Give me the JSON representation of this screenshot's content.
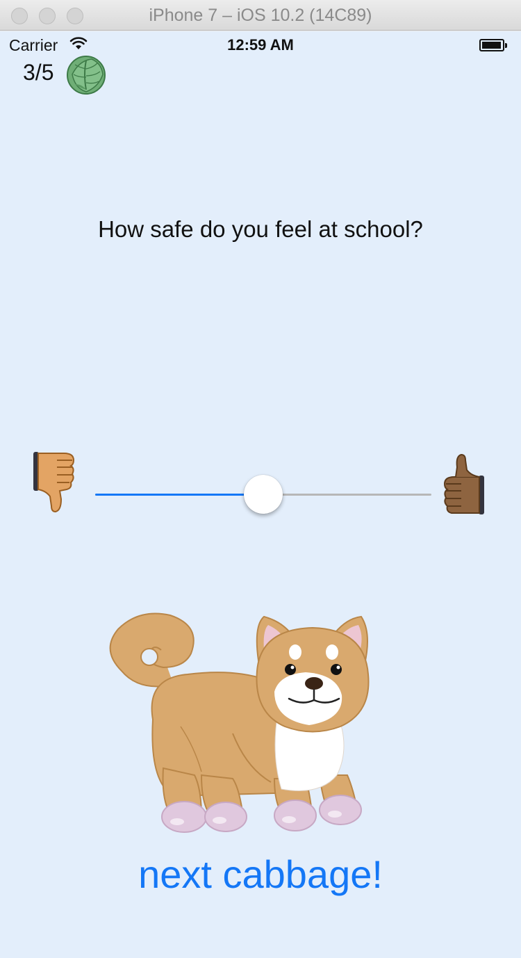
{
  "window": {
    "title": "iPhone 7 – iOS 10.2 (14C89)"
  },
  "status_bar": {
    "carrier": "Carrier",
    "time": "12:59 AM"
  },
  "header": {
    "progress": "3/5"
  },
  "survey": {
    "question": "How safe do you feel at school?",
    "slider_value": 0.5,
    "min_icon": "thumbs-down-icon",
    "max_icon": "thumbs-up-icon"
  },
  "footer": {
    "next_label": "next cabbage!"
  },
  "colors": {
    "background": "#e3eefb",
    "accent": "#1477f6",
    "track": "#b7b7b7"
  }
}
